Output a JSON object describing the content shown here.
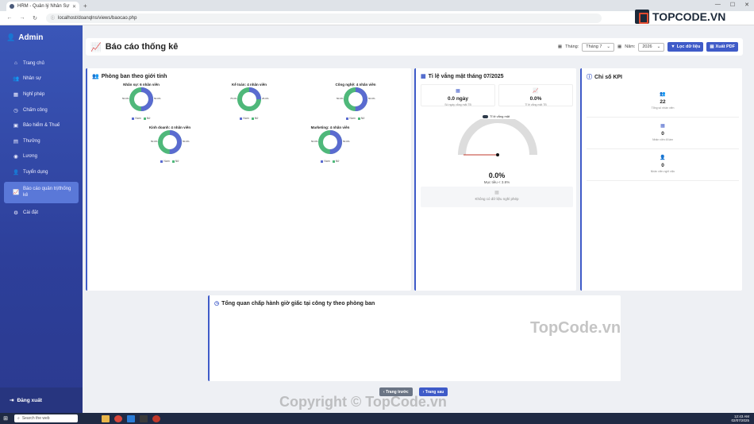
{
  "browser": {
    "tab_title": "HRM - Quản lý Nhân Sự",
    "url": "localhost/doanqlns/views/baocao.php"
  },
  "sidebar": {
    "brand": "Admin",
    "items": [
      {
        "label": "Trang chủ",
        "icon": "home-icon"
      },
      {
        "label": "Nhân sự",
        "icon": "users-icon"
      },
      {
        "label": "Nghỉ phép",
        "icon": "calendar-icon"
      },
      {
        "label": "Chấm công",
        "icon": "clock-icon"
      },
      {
        "label": "Bảo hiểm & Thuế",
        "icon": "shield-icon"
      },
      {
        "label": "Thưởng",
        "icon": "gift-icon"
      },
      {
        "label": "Lương",
        "icon": "money-icon"
      },
      {
        "label": "Tuyển dụng",
        "icon": "user-plus-icon"
      },
      {
        "label": "Báo cáo quản trị/thống kê",
        "icon": "chart-icon"
      },
      {
        "label": "Cài đặt",
        "icon": "gear-icon"
      }
    ],
    "logout": "Đăng xuất"
  },
  "header": {
    "title": "Báo cáo thống kê",
    "month_label": "Tháng:",
    "month_value": "Tháng 7",
    "year_label": "Năm:",
    "year_value": "2026",
    "filter_button": "Lọc dữ liệu",
    "export_button": "Xuất PDF"
  },
  "gender_card": {
    "title": "Phòng ban theo giới tính",
    "legend_male": "Nam",
    "legend_female": "Nữ",
    "charts": [
      {
        "title": "Nhân sự: 6 nhân viên",
        "male_pct": 50,
        "female_pct": 50
      },
      {
        "title": "Kế toán: 4 nhân viên",
        "male_pct": 25,
        "female_pct": 75
      },
      {
        "title": "Công nghệ: 4 nhân viên",
        "male_pct": 50,
        "female_pct": 50
      },
      {
        "title": "Kinh doanh: 4 nhân viên",
        "male_pct": 50,
        "female_pct": 50
      },
      {
        "title": "Marketing: 4 nhân viên",
        "male_pct": 50,
        "female_pct": 50
      }
    ],
    "colors": {
      "male": "#5a6bd0",
      "female": "#4fb87a"
    }
  },
  "absence_card": {
    "title": "Tỉ lệ vắng mặt tháng 07/2025",
    "stat1_value": "0.0 ngày",
    "stat1_label": "Số ngày vắng mặt TB",
    "stat2_value": "0.0%",
    "stat2_label": "Tỉ lệ vắng mặt TB",
    "gauge_legend": "Tỉ lệ vắng mặt",
    "gauge_value": "0.0%",
    "gauge_target": "Mục tiêu < 3.8%",
    "gauge_pct": 0,
    "empty_text": "Không có dữ liệu nghỉ phép"
  },
  "kpi_card": {
    "title": "Chỉ số KPI",
    "rows": [
      {
        "value": "22",
        "label": "Tổng số nhân viên",
        "icon": "users-icon"
      },
      {
        "value": "0",
        "label": "Nhân viên đi làm",
        "icon": "clipboard-icon"
      },
      {
        "value": "0",
        "label": "Nhân viên nghỉ việc",
        "icon": "user-minus-icon"
      }
    ]
  },
  "discipline_card": {
    "title": "Tổng quan chấp hành giờ giấc tại công ty theo phòng ban"
  },
  "pager": {
    "prev": "Trang trước",
    "next": "Trang sau"
  },
  "taskbar": {
    "search": "Search the web",
    "time": "12:43 AM",
    "date": "02/07/2025"
  },
  "watermarks": {
    "logo": "TOPCODE.VN",
    "center": "TopCode.vn",
    "bottom": "Copyright © TopCode.vn"
  }
}
